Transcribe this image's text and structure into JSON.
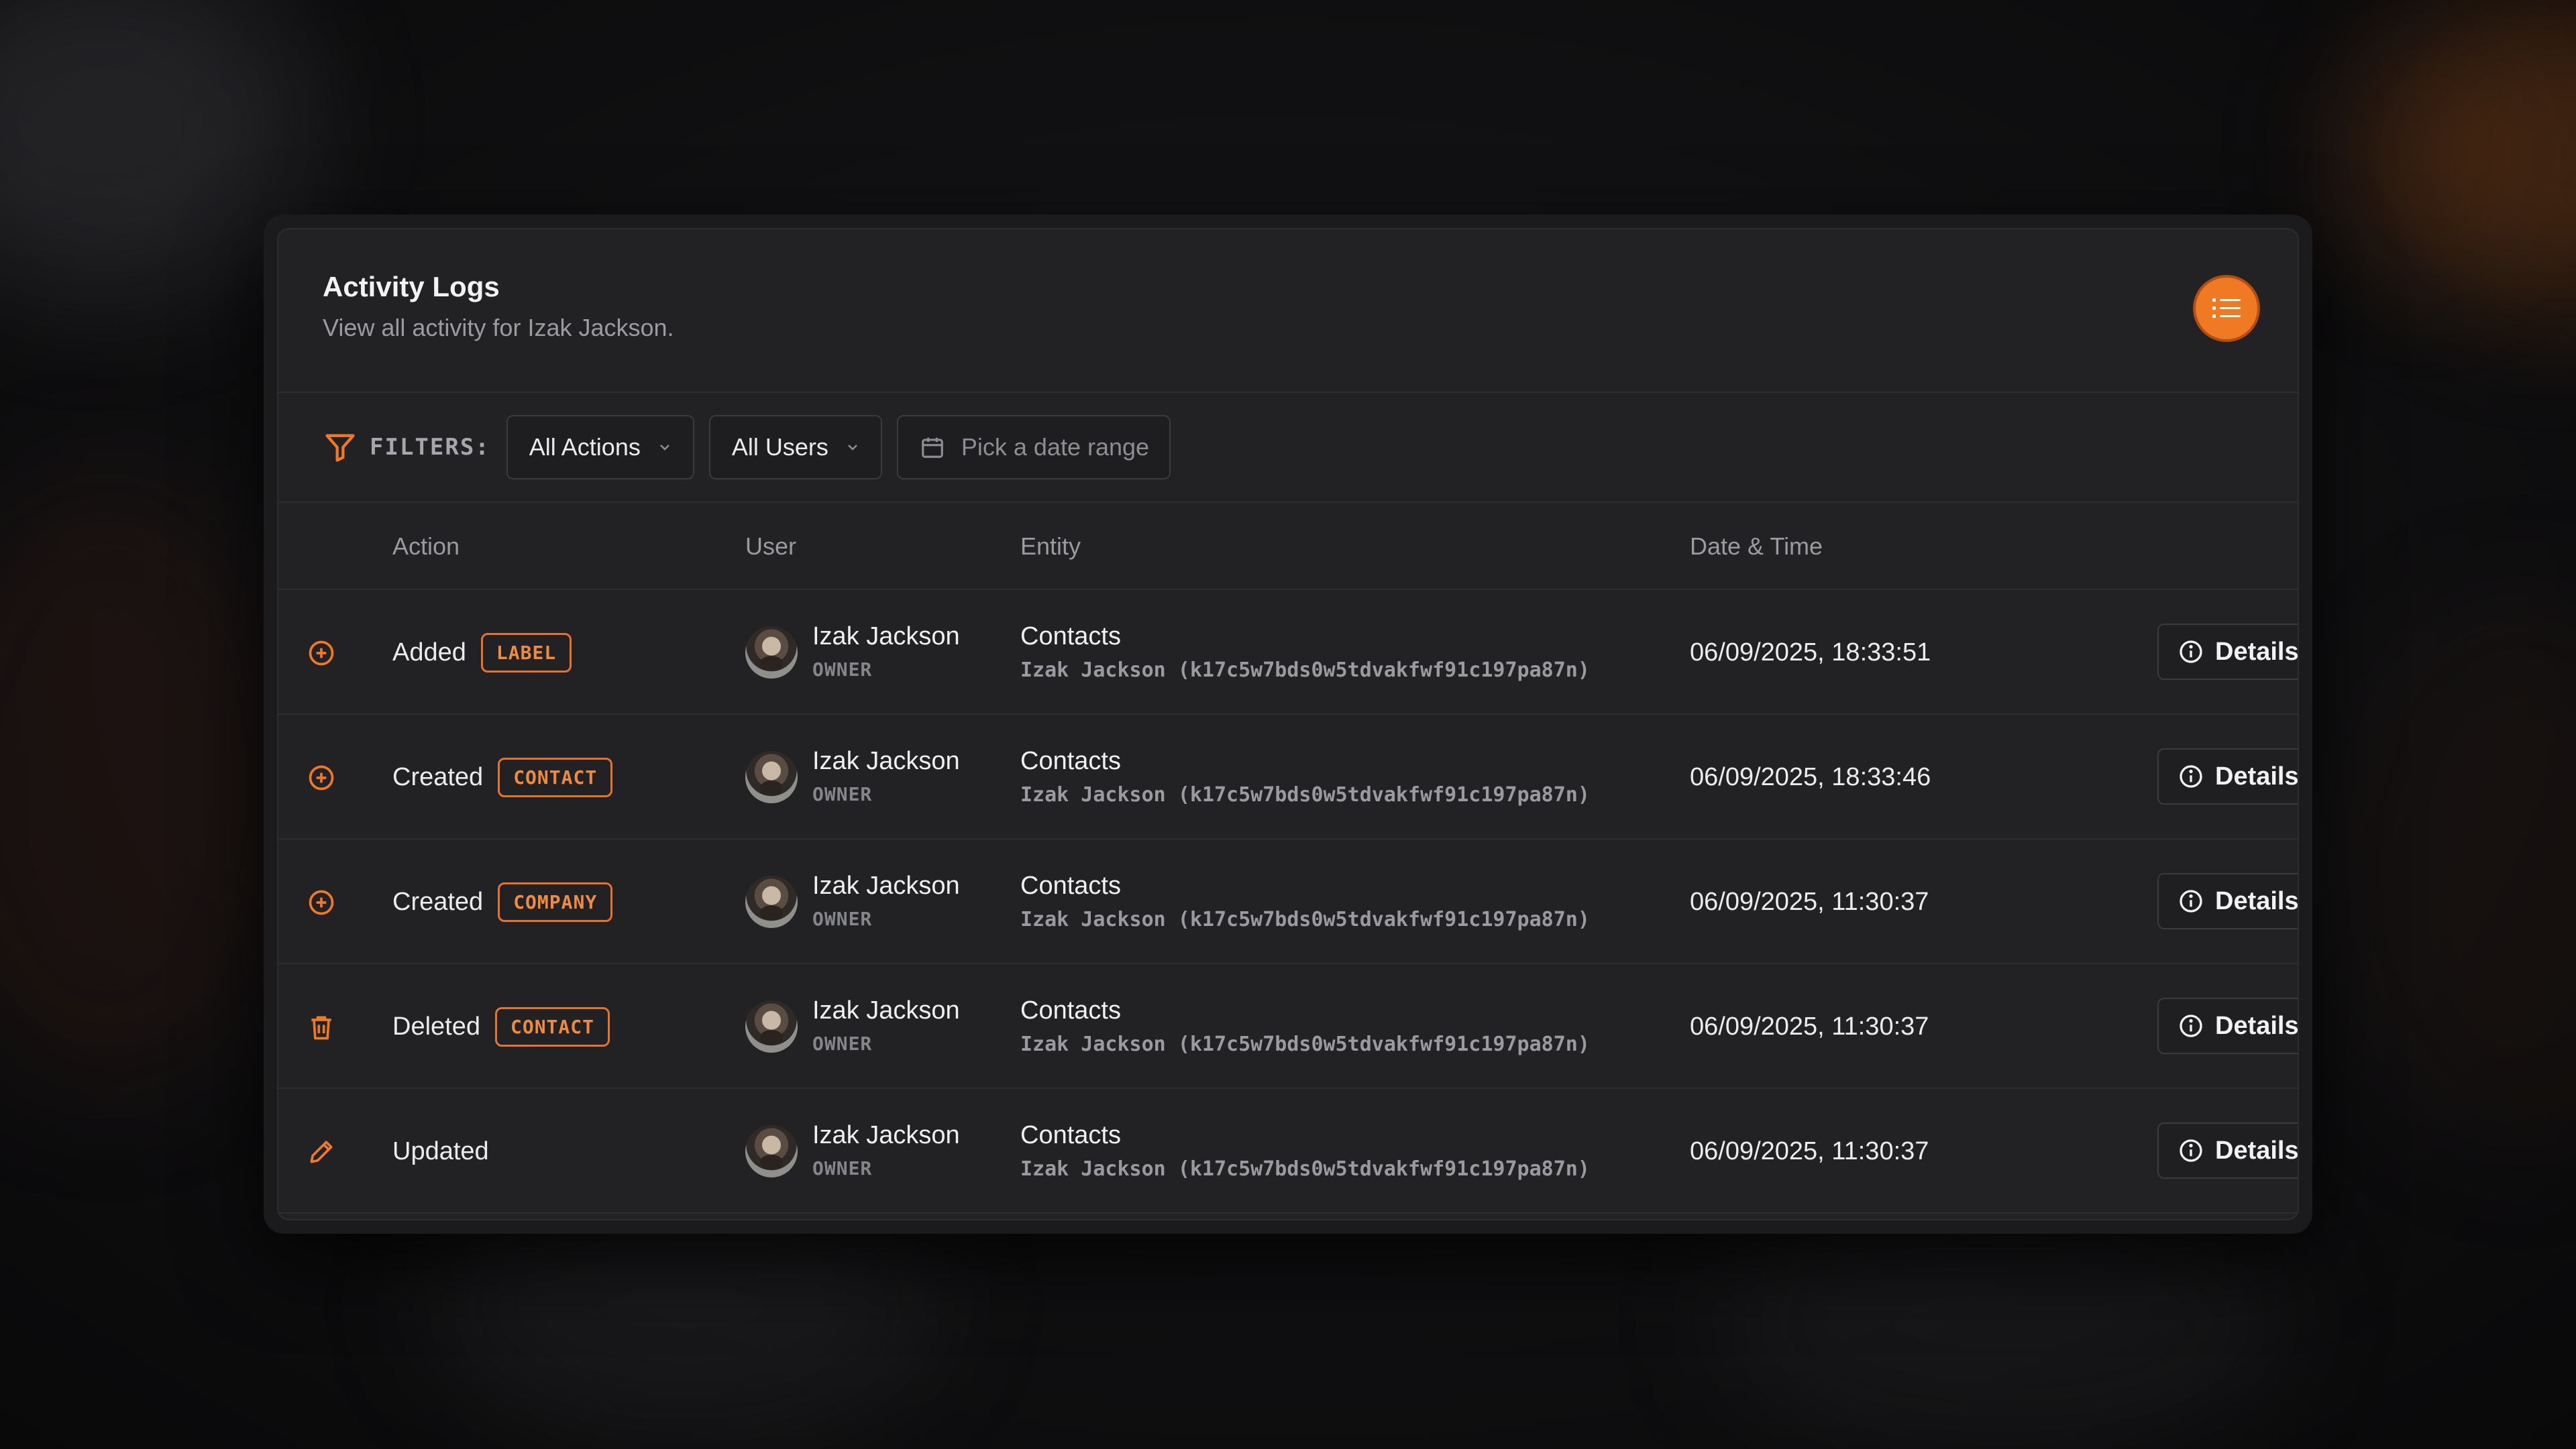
{
  "header": {
    "title": "Activity Logs",
    "subtitle": "View all activity for Izak Jackson."
  },
  "filters": {
    "label": "FILTERS:",
    "action_select": "All Actions",
    "user_select": "All Users",
    "date_placeholder": "Pick a date range"
  },
  "columns": {
    "action": "Action",
    "user": "User",
    "entity": "Entity",
    "datetime": "Date & Time"
  },
  "rows": [
    {
      "icon": "plus-circle-icon",
      "action": "Added",
      "badge": "LABEL",
      "user": "Izak Jackson",
      "role": "OWNER",
      "entity": "Contacts",
      "entity_detail": "Izak Jackson (k17c5w7bds0w5tdvakfwf91c197pa87n)",
      "datetime": "06/09/2025, 18:33:51",
      "details_label": "Details"
    },
    {
      "icon": "plus-circle-icon",
      "action": "Created",
      "badge": "CONTACT",
      "user": "Izak Jackson",
      "role": "OWNER",
      "entity": "Contacts",
      "entity_detail": "Izak Jackson (k17c5w7bds0w5tdvakfwf91c197pa87n)",
      "datetime": "06/09/2025, 18:33:46",
      "details_label": "Details"
    },
    {
      "icon": "plus-circle-icon",
      "action": "Created",
      "badge": "COMPANY",
      "user": "Izak Jackson",
      "role": "OWNER",
      "entity": "Contacts",
      "entity_detail": "Izak Jackson (k17c5w7bds0w5tdvakfwf91c197pa87n)",
      "datetime": "06/09/2025, 11:30:37",
      "details_label": "Details"
    },
    {
      "icon": "trash-icon",
      "action": "Deleted",
      "badge": "CONTACT",
      "user": "Izak Jackson",
      "role": "OWNER",
      "entity": "Contacts",
      "entity_detail": "Izak Jackson (k17c5w7bds0w5tdvakfwf91c197pa87n)",
      "datetime": "06/09/2025, 11:30:37",
      "details_label": "Details"
    },
    {
      "icon": "pencil-icon",
      "action": "Updated",
      "badge": "",
      "user": "Izak Jackson",
      "role": "OWNER",
      "entity": "Contacts",
      "entity_detail": "Izak Jackson (k17c5w7bds0w5tdvakfwf91c197pa87n)",
      "datetime": "06/09/2025, 11:30:37",
      "details_label": "Details"
    }
  ],
  "colors": {
    "accent": "#f07a23",
    "card_bg": "#222225",
    "page_bg": "#0c0c0e"
  }
}
